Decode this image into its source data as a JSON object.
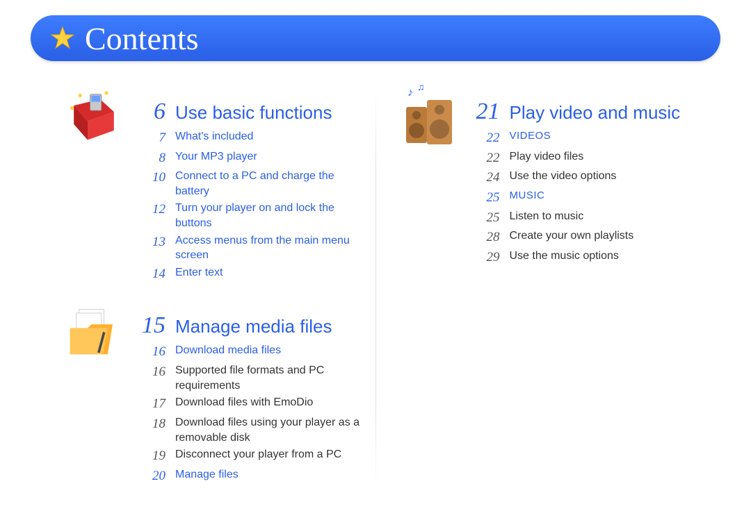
{
  "header": {
    "title": "Contents"
  },
  "left_column": [
    {
      "icon": "gift-box-icon",
      "page": "6",
      "title": "Use basic functions",
      "entries": [
        {
          "page": "7",
          "text": "What's included",
          "level": "topic"
        },
        {
          "page": "8",
          "text": "Your MP3 player",
          "level": "topic"
        },
        {
          "page": "10",
          "text": "Connect to a PC and charge the battery",
          "level": "topic"
        },
        {
          "page": "12",
          "text": "Turn your player on and lock the buttons",
          "level": "topic"
        },
        {
          "page": "13",
          "text": "Access menus from the main menu screen",
          "level": "topic"
        },
        {
          "page": "14",
          "text": "Enter text",
          "level": "topic"
        }
      ]
    },
    {
      "icon": "folder-files-icon",
      "page": "15",
      "title": "Manage media files",
      "entries": [
        {
          "page": "16",
          "text": "Download media files",
          "level": "topic"
        },
        {
          "page": "16",
          "text": "Supported file formats and PC requirements",
          "level": "item"
        },
        {
          "page": "17",
          "text": "Download files with EmoDio",
          "level": "item"
        },
        {
          "page": "18",
          "text": "Download files using your player as a removable disk",
          "level": "item"
        },
        {
          "page": "19",
          "text": "Disconnect your player from a PC",
          "level": "item"
        },
        {
          "page": "20",
          "text": "Manage files",
          "level": "topic"
        }
      ]
    }
  ],
  "right_column": [
    {
      "icon": "speakers-music-icon",
      "page": "21",
      "title": "Play video and music",
      "entries": [
        {
          "page": "22",
          "text": "VIDEOS",
          "level": "subheading"
        },
        {
          "page": "22",
          "text": "Play video files",
          "level": "item"
        },
        {
          "page": "24",
          "text": "Use the video options",
          "level": "item"
        },
        {
          "page": "25",
          "text": "MUSIC",
          "level": "subheading"
        },
        {
          "page": "25",
          "text": "Listen to music",
          "level": "item"
        },
        {
          "page": "28",
          "text": "Create your own playlists",
          "level": "item"
        },
        {
          "page": "29",
          "text": "Use the music options",
          "level": "item"
        }
      ]
    }
  ]
}
